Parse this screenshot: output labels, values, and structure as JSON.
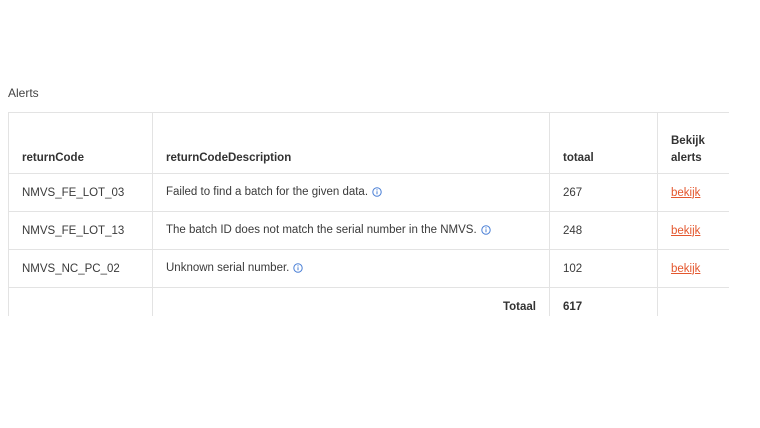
{
  "section": {
    "title": "Alerts"
  },
  "table": {
    "headers": {
      "returnCode": "returnCode",
      "returnCodeDescription": "returnCodeDescription",
      "totaal": "totaal",
      "bekijk_alerts_line1": "Bekijk",
      "bekijk_alerts_line2": "alerts"
    },
    "rows": [
      {
        "returnCode": "NMVS_FE_LOT_03",
        "description": "Failed to find a batch for the given data.",
        "totaal": "267",
        "link": "bekijk"
      },
      {
        "returnCode": "NMVS_FE_LOT_13",
        "description": "The batch ID does not match the serial number in the NMVS.",
        "totaal": "248",
        "link": "bekijk"
      },
      {
        "returnCode": "NMVS_NC_PC_02",
        "description": "Unknown serial number.",
        "totaal": "102",
        "link": "bekijk"
      }
    ],
    "footer": {
      "label": "Totaal",
      "total": "617"
    }
  },
  "colors": {
    "link": "#e4572e",
    "info_icon": "#4a7fd6",
    "border": "#e3e3e3"
  },
  "icons": {
    "info": "info-circle-icon"
  }
}
